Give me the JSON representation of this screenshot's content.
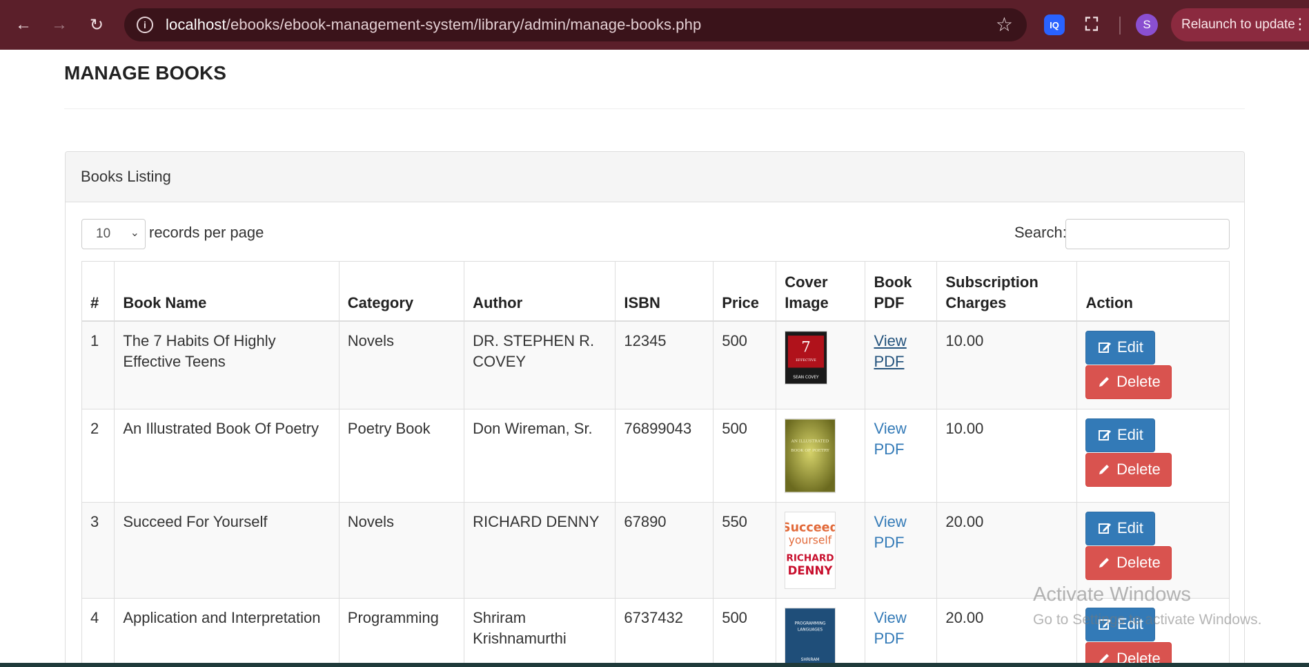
{
  "browser": {
    "url_host": "localhost",
    "url_path": "/ebooks/ebook-management-system/library/admin/manage-books.php",
    "profile_initial": "S",
    "relaunch_label": "Relaunch to update",
    "extension_label": "IQ"
  },
  "page": {
    "title": "MANAGE BOOKS",
    "panel_heading": "Books Listing",
    "length_value": "10",
    "length_label": "records per page",
    "search_label": "Search:",
    "search_value": ""
  },
  "table": {
    "headers": [
      "#",
      "Book Name",
      "Category",
      "Author",
      "ISBN",
      "Price",
      "Cover Image",
      "Book PDF",
      "Subscription Charges",
      "Action"
    ],
    "edit_label": "Edit",
    "delete_label": "Delete",
    "view_pdf_label": "View PDF",
    "rows": [
      {
        "num": "1",
        "name": "The 7 Habits Of Highly Effective Teens",
        "category": "Novels",
        "author": "DR. STEPHEN R. COVEY",
        "isbn": "12345",
        "price": "500",
        "charges": "10.00",
        "cover_text": "7 HABITS OF HIGHLY EFFECTIVE TEENAGERS",
        "cover_author": "SEAN COVEY"
      },
      {
        "num": "2",
        "name": "An Illustrated Book Of Poetry",
        "category": "Poetry Book",
        "author": "Don Wireman, Sr.",
        "isbn": "76899043",
        "price": "500",
        "charges": "10.00",
        "cover_text": "AN ILLUSTRATED BOOK OF POETRY",
        "cover_author": ""
      },
      {
        "num": "3",
        "name": "Succeed For Yourself",
        "category": "Novels",
        "author": "RICHARD DENNY",
        "isbn": "67890",
        "price": "550",
        "charges": "20.00",
        "cover_text": "Succeed yourself",
        "cover_author": "RICHARD DENNY"
      },
      {
        "num": "4",
        "name": "Application and Interpretation",
        "category": "Programming",
        "author": "Shriram Krishnamurthi",
        "isbn": "6737432",
        "price": "500",
        "charges": "20.00",
        "cover_text": "PROGRAMMING LANGUAGES APPLICATION AND INTERPRETATION",
        "cover_author": "SHRIRAM"
      }
    ]
  },
  "watermark": {
    "line1": "Activate Windows",
    "line2": "Go to Settings to activate Windows."
  }
}
